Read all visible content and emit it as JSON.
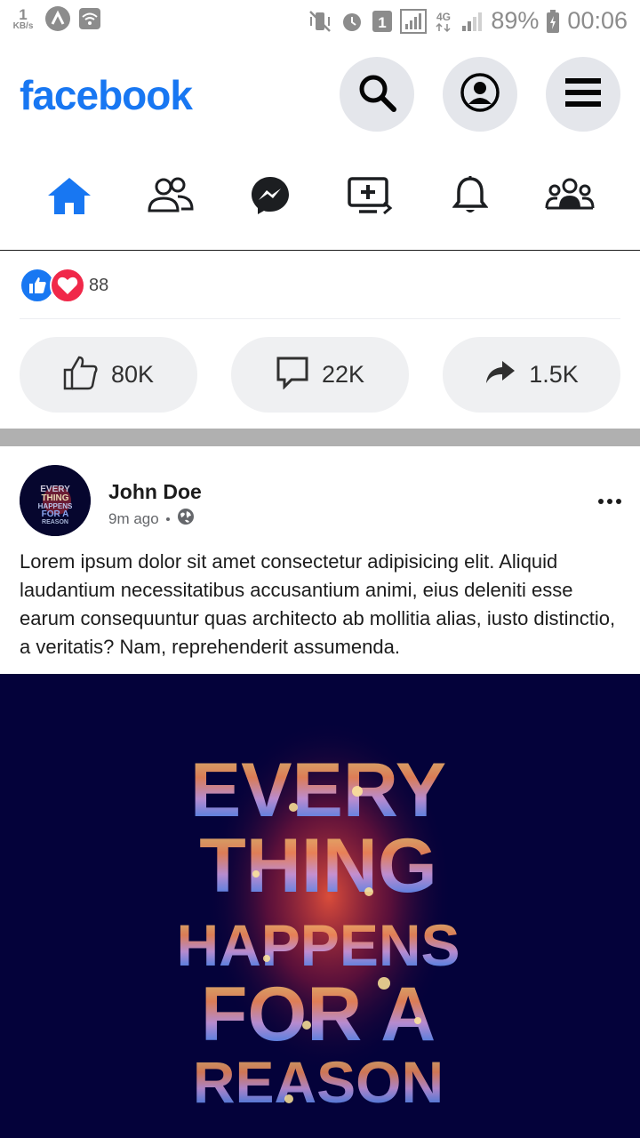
{
  "status_bar": {
    "speed_value": "1",
    "speed_unit": "KB/s",
    "battery": "89%",
    "time": "00:06",
    "sim_slot": "1",
    "network": "4G"
  },
  "header": {
    "logo": "facebook",
    "brand_color": "#1877f2"
  },
  "tabs": [
    {
      "name": "home",
      "icon": "home-icon",
      "active": true
    },
    {
      "name": "friends",
      "icon": "friends-icon"
    },
    {
      "name": "messenger",
      "icon": "messenger-icon"
    },
    {
      "name": "watch",
      "icon": "video-add-icon"
    },
    {
      "name": "notifications",
      "icon": "bell-icon"
    },
    {
      "name": "groups",
      "icon": "groups-icon"
    }
  ],
  "reactions": {
    "count": "88"
  },
  "actions": {
    "like_count": "80K",
    "comment_count": "22K",
    "share_count": "1.5K"
  },
  "post": {
    "author": "John Doe",
    "time": "9m ago",
    "text": "Lorem ipsum dolor sit amet consectetur adipisicing elit. Aliquid laudantium necessitatibus accusantium animi, eius deleniti esse earum consequuntur quas architecto ab mollitia alias, iusto distinctio, a veritatis? Nam, reprehenderit assumenda.",
    "image_lines": [
      "EVERY",
      "THING",
      "HAPPENS",
      "FOR A",
      "REASON"
    ]
  }
}
